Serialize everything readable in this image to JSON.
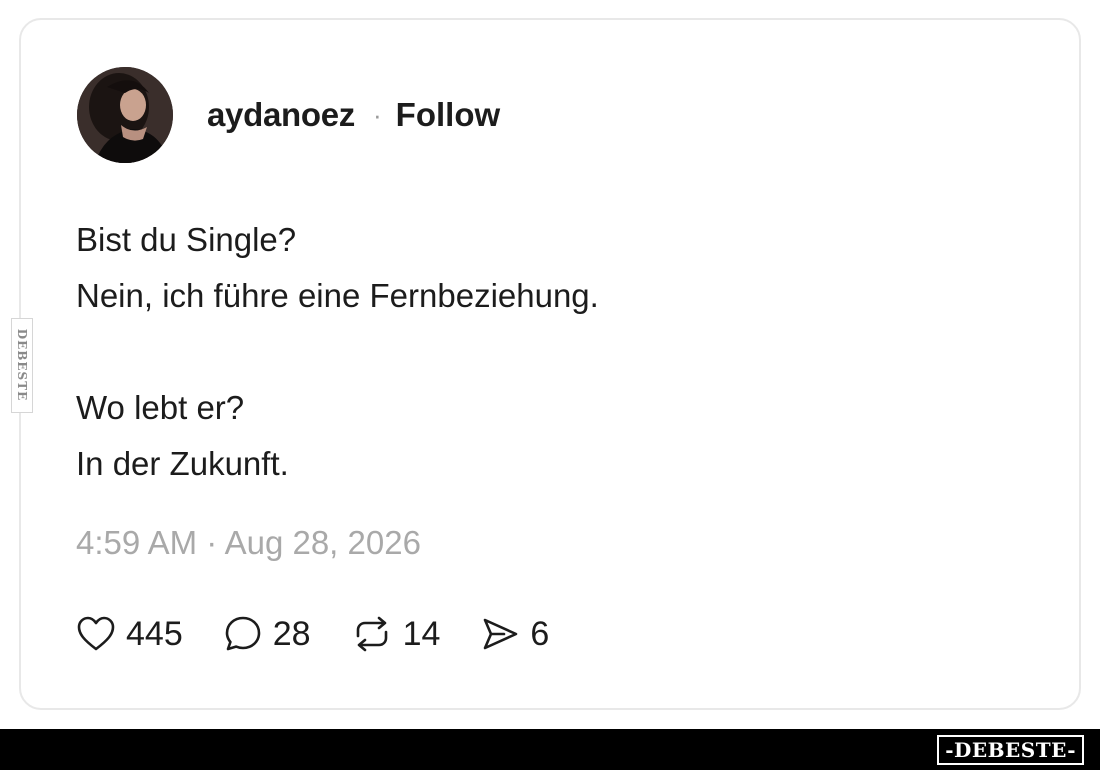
{
  "post": {
    "username": "aydanoez",
    "separator": "·",
    "follow_label": "Follow",
    "lines": [
      "Bist du Single?",
      "Nein, ich führe eine Fernbeziehung.",
      "",
      "Wo lebt er?",
      "In der Zukunft."
    ],
    "timestamp": "4:59 AM · Aug 28, 2026"
  },
  "actions": {
    "likes": "445",
    "replies": "28",
    "reposts": "14",
    "shares": "6"
  },
  "icons": {
    "like": "heart-icon",
    "reply": "speech-bubble-icon",
    "repost": "repost-icon",
    "share": "send-icon"
  },
  "watermark": {
    "side": "DEBESTE",
    "footer": "-DEBESTE-"
  },
  "colors": {
    "text": "#1c1c1c",
    "muted": "#a9a9a9",
    "card_border": "#e8e8e8",
    "footer_bar": "#000000"
  }
}
